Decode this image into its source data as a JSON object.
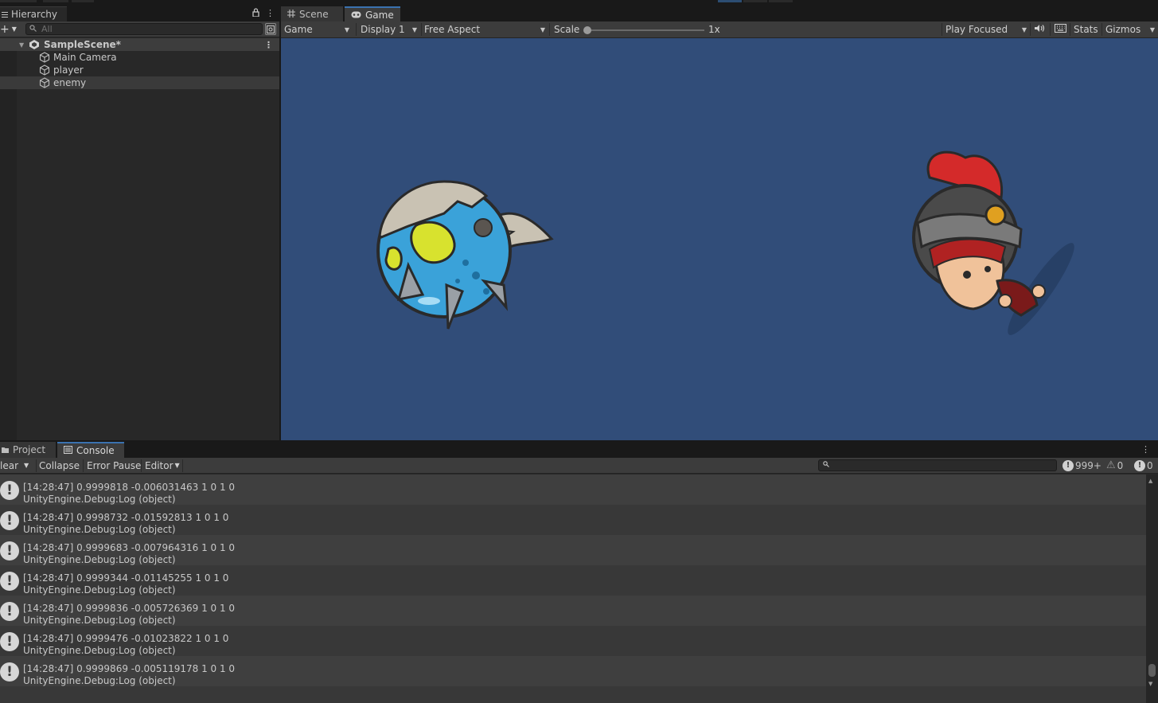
{
  "hierarchy": {
    "tab_label": "Hierarchy",
    "add_label": "+",
    "search_placeholder": "All",
    "scene_name": "SampleScene*",
    "objects": [
      "Main Camera",
      "player",
      "enemy"
    ]
  },
  "game_view": {
    "tabs": {
      "scene": "Scene",
      "game": "Game"
    },
    "toolbar": {
      "mode": "Game",
      "display": "Display 1",
      "aspect": "Free Aspect",
      "scale_label": "Scale",
      "scale_value": "1x",
      "play_focused": "Play Focused",
      "stats": "Stats",
      "gizmos": "Gizmos"
    },
    "background_color": "#314d79"
  },
  "console": {
    "tabs": {
      "project": "Project",
      "console": "Console"
    },
    "toolbar": {
      "clear": "lear",
      "collapse": "Collapse",
      "error_pause": "Error Pause",
      "editor": "Editor",
      "log_count": "999+",
      "warn_count": "0",
      "error_count": "0"
    },
    "entries": [
      {
        "line1": "[14:28:47] 0.9999818 -0.006031463 1 0 1 0",
        "line2": "UnityEngine.Debug:Log (object)"
      },
      {
        "line1": "[14:28:47] 0.9998732 -0.01592813 1 0 1 0",
        "line2": "UnityEngine.Debug:Log (object)"
      },
      {
        "line1": "[14:28:47] 0.9999683 -0.007964316 1 0 1 0",
        "line2": "UnityEngine.Debug:Log (object)"
      },
      {
        "line1": "[14:28:47] 0.9999344 -0.01145255 1 0 1 0",
        "line2": "UnityEngine.Debug:Log (object)"
      },
      {
        "line1": "[14:28:47] 0.9999836 -0.005726369 1 0 1 0",
        "line2": "UnityEngine.Debug:Log (object)"
      },
      {
        "line1": "[14:28:47] 0.9999476 -0.01023822 1 0 1 0",
        "line2": "UnityEngine.Debug:Log (object)"
      },
      {
        "line1": "[14:28:47] 0.9999869 -0.005119178 1 0 1 0",
        "line2": "UnityEngine.Debug:Log (object)"
      }
    ]
  },
  "icons": {
    "hierarchy_menu": "hamburger-icon",
    "lock": "lock-icon",
    "kebab": "kebab-menu-icon",
    "search": "search-icon",
    "scene": "unity-scene-icon",
    "gameobject": "cube-icon",
    "scene_tab": "grid-icon",
    "game_tab": "gamepad-icon",
    "mute": "speaker-icon",
    "keyboard": "keyboard-icon",
    "log": "info-icon",
    "warning": "warning-icon",
    "error": "error-icon"
  },
  "colors": {
    "accent": "#3a72b0",
    "panel": "#282828",
    "toolbar": "#3c3c3c"
  }
}
